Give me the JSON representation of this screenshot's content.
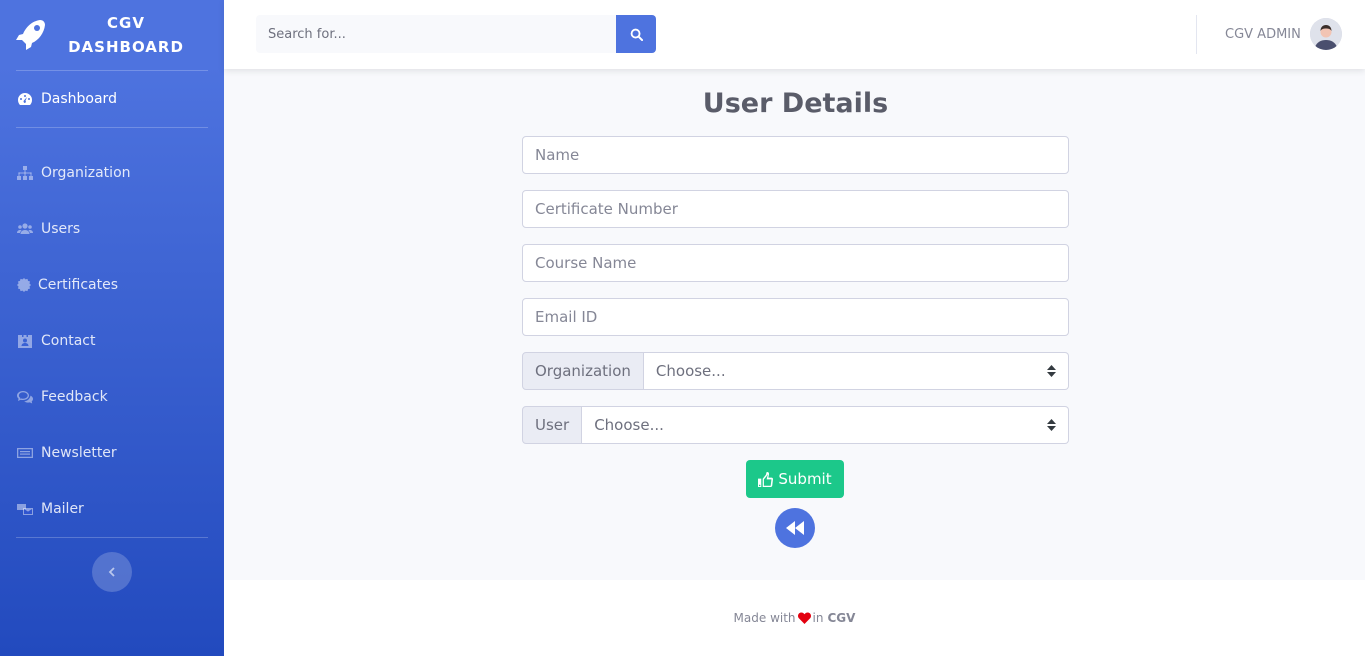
{
  "sidebar": {
    "brand_line1": "CGV",
    "brand_line2": "DASHBOARD",
    "dashboard": {
      "label": "Dashboard",
      "icon": "tachometer-icon"
    },
    "items": [
      {
        "label": "Organization",
        "icon": "sitemap-icon"
      },
      {
        "label": "Users",
        "icon": "users-icon"
      },
      {
        "label": "Certificates",
        "icon": "certificate-icon"
      },
      {
        "label": "Contact",
        "icon": "address-book-icon"
      },
      {
        "label": "Feedback",
        "icon": "comments-icon"
      },
      {
        "label": "Newsletter",
        "icon": "newspaper-icon"
      },
      {
        "label": "Mailer",
        "icon": "mail-bulk-icon"
      }
    ],
    "toggle_icon": "chevron-left-icon"
  },
  "topbar": {
    "search_placeholder": "Search for...",
    "search_icon": "search-icon",
    "user_name": "CGV ADMIN"
  },
  "form": {
    "title": "User Details",
    "name_placeholder": "Name",
    "certificate_placeholder": "Certificate Number",
    "course_placeholder": "Course Name",
    "email_placeholder": "Email ID",
    "organization_label": "Organization",
    "organization_value": "Choose...",
    "user_label": "User",
    "user_value": "Choose...",
    "submit_label": "Submit",
    "back_icon": "backward-icon"
  },
  "footer": {
    "made_with": "Made with",
    "in_text": "in",
    "brand": "CGV"
  },
  "colors": {
    "primary": "#4e73df",
    "success": "#1cc88a",
    "heart": "#e3000f"
  }
}
